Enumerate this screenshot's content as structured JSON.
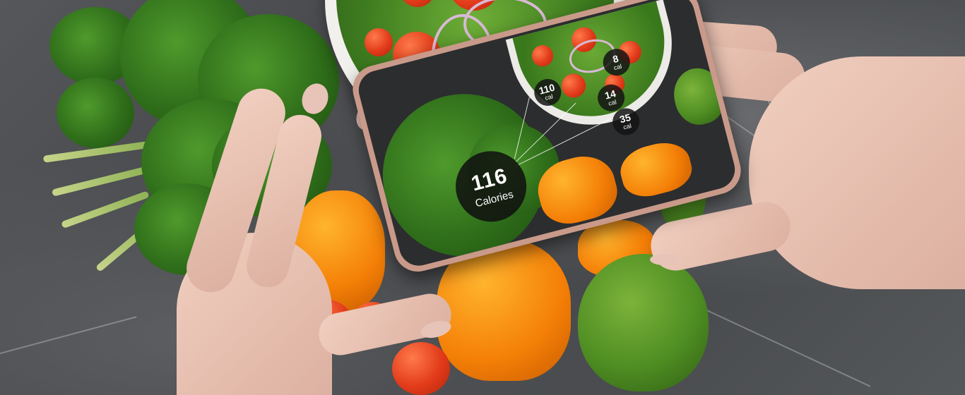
{
  "phone": {
    "total": {
      "value": "116",
      "unit": "Calories"
    },
    "items": [
      {
        "value": "110",
        "unit": "cal"
      },
      {
        "value": "8",
        "unit": "cal"
      },
      {
        "value": "14",
        "unit": "cal"
      },
      {
        "value": "35",
        "unit": "cal"
      }
    ]
  },
  "colors": {
    "marble": "#4b4d50",
    "phone_case": "#c99a8a",
    "badge": "#141414",
    "pepper": "#f47f07",
    "avocado": "#4f8e23"
  }
}
